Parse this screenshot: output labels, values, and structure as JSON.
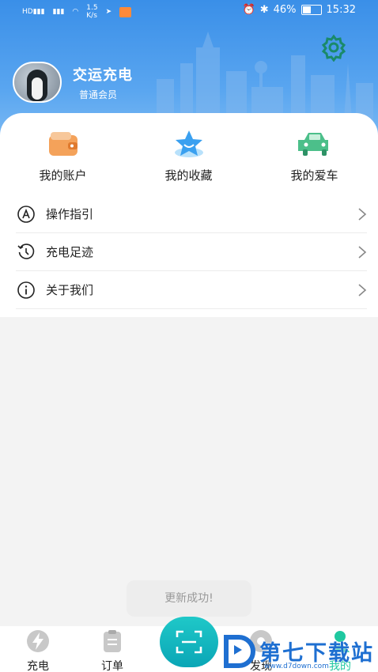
{
  "status_bar": {
    "net_speed_value": "1.5",
    "net_speed_unit": "K/s",
    "battery": "46%",
    "time": "15:32"
  },
  "profile": {
    "name": "交运充电",
    "level": "普通会员"
  },
  "quick_actions": [
    {
      "label": "我的账户",
      "icon": "wallet-icon"
    },
    {
      "label": "我的收藏",
      "icon": "star-icon"
    },
    {
      "label": "我的爱车",
      "icon": "car-icon"
    }
  ],
  "menu": [
    {
      "label": "操作指引",
      "icon": "guide-icon"
    },
    {
      "label": "充电足迹",
      "icon": "history-icon"
    },
    {
      "label": "关于我们",
      "icon": "info-icon"
    }
  ],
  "toast": "更新成功!",
  "tabs": [
    {
      "label": "充电",
      "icon": "lightning-icon"
    },
    {
      "label": "订单",
      "icon": "order-icon"
    },
    {
      "label": "扫码",
      "icon": "scan-icon"
    },
    {
      "label": "发现",
      "icon": "discover-icon"
    },
    {
      "label": "我的",
      "icon": "user-icon"
    }
  ],
  "watermark": {
    "text": "第七下载站",
    "url": "www.d7down.com"
  },
  "colors": {
    "header_top": "#3a8fe8",
    "accent_teal": "#1fc8c8",
    "settings_green": "#1a8a6a"
  }
}
